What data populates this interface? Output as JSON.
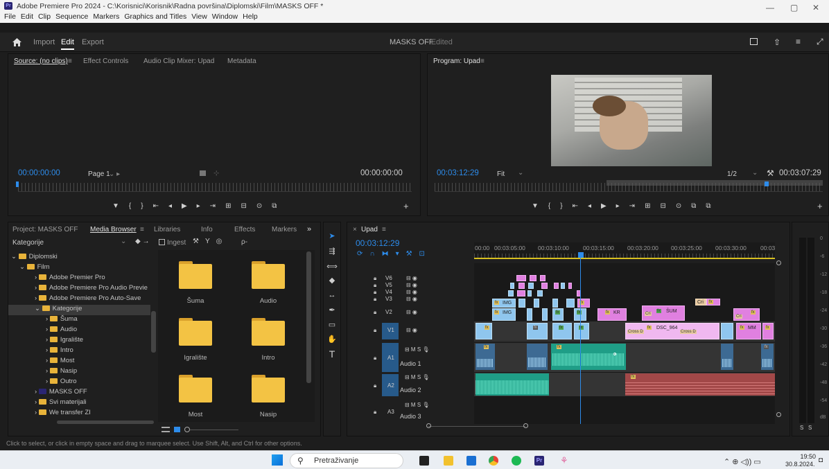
{
  "window": {
    "title": "Adobe Premiere Pro 2024 - C:\\Korisnici\\Korisnik\\Radna površina\\Diplomski\\Film\\MASKS OFF *",
    "app_badge": "Pr",
    "minimize": "—",
    "restore": "▢",
    "close": "✕"
  },
  "menu": [
    "File",
    "Edit",
    "Clip",
    "Sequence",
    "Markers",
    "Graphics and Titles",
    "View",
    "Window",
    "Help"
  ],
  "workspace": {
    "home_icon": "home-icon",
    "import": "Import",
    "edit": "Edit",
    "export": "Export",
    "project": "MASKS OFF",
    "status": "- Edited"
  },
  "source": {
    "tabs": [
      "Source: (no clips)",
      "Effect Controls",
      "Audio Clip Mixer: Upad",
      "Metadata"
    ],
    "tab_menu": "≡",
    "timecode_left": "00:00:00:00",
    "page": "Page 1",
    "timecode_right": "00:00:00:00"
  },
  "program": {
    "tab": "Program: Upad",
    "tab_menu": "≡",
    "timecode": "00:03:12:29",
    "fit": "Fit",
    "res": "1/2",
    "duration": "00:03:07:29"
  },
  "project_panel": {
    "tabs": [
      "Project: MASKS OFF",
      "Media Browser",
      "Libraries",
      "Info",
      "Effects",
      "Markers"
    ],
    "more": "»",
    "dropdown": "Kategorije",
    "ingest": "Ingest",
    "search_placeholder": "ρ-",
    "tree": [
      "Diplomski",
      "Film",
      "Adobe Premier Pro",
      "Adobe Premiere Pro Audio Previe",
      "Adobe Premiere Pro Auto-Save",
      "Kategorije",
      "Šuma",
      "Audio",
      "Igralište",
      "Intro",
      "Most",
      "Nasip",
      "Outro",
      "MASKS OFF",
      "Svi materijali",
      "We transfer ZI"
    ],
    "folders": [
      "Šuma",
      "Audio",
      "Igralište",
      "Intro",
      "Most",
      "Nasip"
    ]
  },
  "timeline": {
    "tab": "Upad",
    "tab_menu": "≡",
    "timecode": "00:03:12:29",
    "ticks": [
      "00:00",
      "00:03:05:00",
      "00:03:10:00",
      "00:03:15:00",
      "00:03:20:00",
      "00:03:25:00",
      "00:03:30:00",
      "00:03"
    ],
    "video_tracks": [
      "V6",
      "V5",
      "V4",
      "V3",
      "V2",
      "V1"
    ],
    "audio_tracks": [
      {
        "id": "A1",
        "name": "Audio 1"
      },
      {
        "id": "A2",
        "name": "Audio 2"
      },
      {
        "id": "A3",
        "name": "Audio 3"
      }
    ],
    "clip_labels": [
      "IMG",
      "IMG",
      "KR",
      "ŠUM",
      "DSC_964",
      "MM",
      "Cross D",
      "Cross D",
      "Cri",
      "Cri",
      "Cri"
    ],
    "fx": "fx"
  },
  "meter": {
    "labels": [
      "0",
      "-6",
      "-12",
      "-18",
      "-24",
      "-30",
      "-36",
      "-42",
      "-48",
      "-54",
      "dB"
    ],
    "solo": [
      "S",
      "S"
    ]
  },
  "statusbar": "Click to select, or click in empty space and drag to marquee select. Use Shift, Alt, and Ctrl for other options.",
  "taskbar": {
    "search": "Pretraživanje",
    "time": "19:50",
    "date": "30.8.2024."
  }
}
